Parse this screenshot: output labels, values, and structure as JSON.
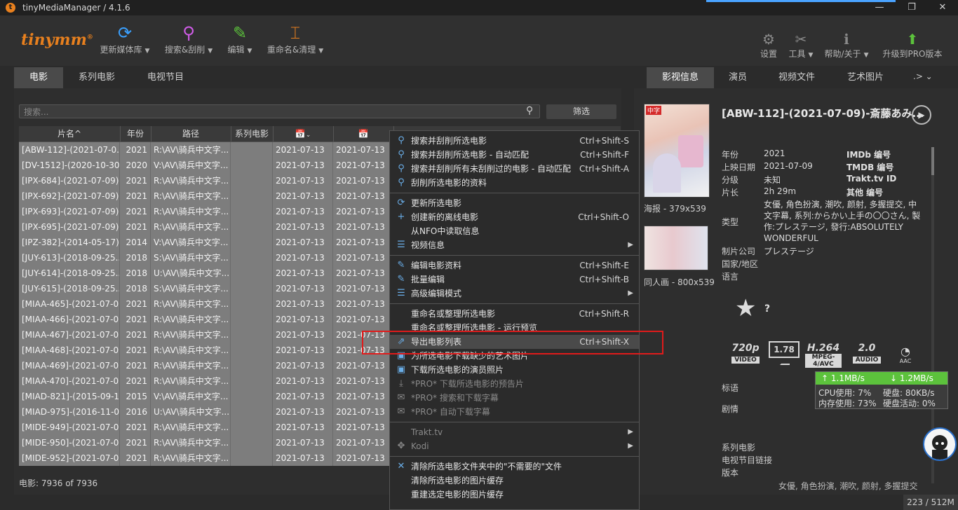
{
  "window": {
    "title": "tinyMediaManager / 4.1.6",
    "minimize": "—",
    "restore": "❐",
    "close": "✕"
  },
  "toolbar": {
    "logo": "tinymm",
    "logo_mark": "®",
    "items": [
      {
        "label": "更新媒体库",
        "icon": "refresh-icon",
        "glyph": "⟳",
        "color": "#3aa0ff"
      },
      {
        "label": "搜索&刮削",
        "icon": "search-magnify-icon",
        "glyph": "⚲",
        "color": "#d05ce8"
      },
      {
        "label": "编辑",
        "icon": "edit-pencil-icon",
        "glyph": "✎",
        "color": "#5cc23c"
      },
      {
        "label": "重命名&清理",
        "icon": "rename-icon",
        "glyph": "⌶",
        "color": "#e8801e"
      }
    ],
    "right_items": [
      {
        "label": "设置",
        "icon": "gear-icon",
        "glyph": "⚙"
      },
      {
        "label": "工具",
        "icon": "wrench-icon",
        "glyph": "✂"
      },
      {
        "label": "帮助/关于",
        "icon": "info-icon",
        "glyph": "ℹ"
      },
      {
        "label": "升级到PRO版本",
        "icon": "upgrade-arrow-icon",
        "glyph": "⬆"
      }
    ]
  },
  "left_tabs": [
    "电影",
    "系列电影",
    "电视节目"
  ],
  "search": {
    "placeholder": "搜索..."
  },
  "filter_label": "筛选",
  "table": {
    "headers": [
      "片名",
      "年份",
      "路径",
      "系列电影",
      "",
      ""
    ],
    "sort_marker": "^",
    "rows": [
      {
        "title": "[ABW-112]-(2021-07-0...",
        "year": "2021",
        "path": "R:\\AV\\骑兵中文字...",
        "series": "",
        "date1": "2021-07-13",
        "date2": "2021-07-13"
      },
      {
        "title": "[DV-1512]-(2020-10-30...",
        "year": "2020",
        "path": "V:\\AV\\骑兵中文字...",
        "series": "",
        "date1": "2021-07-13",
        "date2": "2021-07-13"
      },
      {
        "title": "[IPX-684]-(2021-07-09)...",
        "year": "2021",
        "path": "R:\\AV\\骑兵中文字...",
        "series": "",
        "date1": "2021-07-13",
        "date2": "2021-07-13"
      },
      {
        "title": "[IPX-692]-(2021-07-09)...",
        "year": "2021",
        "path": "R:\\AV\\骑兵中文字...",
        "series": "",
        "date1": "2021-07-13",
        "date2": "2021-07-13"
      },
      {
        "title": "[IPX-693]-(2021-07-09)...",
        "year": "2021",
        "path": "R:\\AV\\骑兵中文字...",
        "series": "",
        "date1": "2021-07-13",
        "date2": "2021-07-13"
      },
      {
        "title": "[IPX-695]-(2021-07-09)...",
        "year": "2021",
        "path": "R:\\AV\\骑兵中文字...",
        "series": "",
        "date1": "2021-07-13",
        "date2": "2021-07-13"
      },
      {
        "title": "[IPZ-382]-(2014-05-17)...",
        "year": "2014",
        "path": "V:\\AV\\骑兵中文字...",
        "series": "",
        "date1": "2021-07-13",
        "date2": "2021-07-13"
      },
      {
        "title": "[JUY-613]-(2018-09-25...",
        "year": "2018",
        "path": "S:\\AV\\骑兵中文字...",
        "series": "",
        "date1": "2021-07-13",
        "date2": "2021-07-13"
      },
      {
        "title": "[JUY-614]-(2018-09-25...",
        "year": "2018",
        "path": "U:\\AV\\骑兵中文字...",
        "series": "",
        "date1": "2021-07-13",
        "date2": "2021-07-13"
      },
      {
        "title": "[JUY-615]-(2018-09-25...",
        "year": "2018",
        "path": "S:\\AV\\骑兵中文字...",
        "series": "",
        "date1": "2021-07-13",
        "date2": "2021-07-13"
      },
      {
        "title": "[MIAA-465]-(2021-07-0...",
        "year": "2021",
        "path": "R:\\AV\\骑兵中文字...",
        "series": "",
        "date1": "2021-07-13",
        "date2": "2021-07-13"
      },
      {
        "title": "[MIAA-466]-(2021-07-0...",
        "year": "2021",
        "path": "R:\\AV\\骑兵中文字...",
        "series": "",
        "date1": "2021-07-13",
        "date2": "2021-07-13"
      },
      {
        "title": "[MIAA-467]-(2021-07-0...",
        "year": "2021",
        "path": "R:\\AV\\骑兵中文字...",
        "series": "",
        "date1": "2021-07-13",
        "date2": "2021-07-13"
      },
      {
        "title": "[MIAA-468]-(2021-07-0...",
        "year": "2021",
        "path": "R:\\AV\\骑兵中文字...",
        "series": "",
        "date1": "2021-07-13",
        "date2": "2021-07-13"
      },
      {
        "title": "[MIAA-469]-(2021-07-0...",
        "year": "2021",
        "path": "R:\\AV\\骑兵中文字...",
        "series": "",
        "date1": "2021-07-13",
        "date2": "2021-07-13"
      },
      {
        "title": "[MIAA-470]-(2021-07-0...",
        "year": "2021",
        "path": "R:\\AV\\骑兵中文字...",
        "series": "",
        "date1": "2021-07-13",
        "date2": "2021-07-13"
      },
      {
        "title": "[MIAD-821]-(2015-09-1...",
        "year": "2015",
        "path": "V:\\AV\\骑兵中文字...",
        "series": "",
        "date1": "2021-07-13",
        "date2": "2021-07-13"
      },
      {
        "title": "[MIAD-975]-(2016-11-0...",
        "year": "2016",
        "path": "U:\\AV\\骑兵中文字...",
        "series": "",
        "date1": "2021-07-13",
        "date2": "2021-07-13"
      },
      {
        "title": "[MIDE-949]-(2021-07-0...",
        "year": "2021",
        "path": "R:\\AV\\骑兵中文字...",
        "series": "",
        "date1": "2021-07-13",
        "date2": "2021-07-13"
      },
      {
        "title": "[MIDE-950]-(2021-07-0...",
        "year": "2021",
        "path": "R:\\AV\\骑兵中文字...",
        "series": "",
        "date1": "2021-07-13",
        "date2": "2021-07-13"
      },
      {
        "title": "[MIDE-952]-(2021-07-0...",
        "year": "2021",
        "path": "R:\\AV\\骑兵中文字...",
        "series": "",
        "date1": "2021-07-13",
        "date2": "2021-07-13"
      }
    ]
  },
  "status": {
    "text": "电影:  7936  of  7936"
  },
  "context_menu": {
    "groups": [
      [
        {
          "label": "搜索并刮削所选电影",
          "shortcut": "Ctrl+Shift-S",
          "icon": "search-icon",
          "glyph": "⚲"
        },
        {
          "label": "搜索并刮削所选电影 - 自动匹配",
          "shortcut": "Ctrl+Shift-F",
          "icon": "search-icon",
          "glyph": "⚲"
        },
        {
          "label": "搜索并刮削所有未刮削过的电影 - 自动匹配",
          "shortcut": "Ctrl+Shift-A",
          "icon": "search-icon",
          "glyph": "⚲"
        },
        {
          "label": "刮削所选电影的资料",
          "shortcut": "",
          "icon": "search-icon",
          "glyph": "⚲"
        }
      ],
      [
        {
          "label": "更新所选电影",
          "shortcut": "",
          "icon": "refresh-icon",
          "glyph": "⟳"
        },
        {
          "label": "创建新的离线电影",
          "shortcut": "Ctrl+Shift-O",
          "icon": "plus-icon",
          "glyph": "+"
        },
        {
          "label": "从NFO中读取信息",
          "shortcut": "",
          "icon": "",
          "glyph": ""
        },
        {
          "label": "视频信息",
          "shortcut": "",
          "icon": "list-icon",
          "glyph": "☰",
          "submenu": true
        }
      ],
      [
        {
          "label": "编辑电影资料",
          "shortcut": "Ctrl+Shift-E",
          "icon": "edit-icon",
          "glyph": "✎"
        },
        {
          "label": "批量编辑",
          "shortcut": "Ctrl+Shift-B",
          "icon": "edit-icon",
          "glyph": "✎"
        },
        {
          "label": "高级编辑模式",
          "shortcut": "",
          "icon": "list-icon",
          "glyph": "☰",
          "submenu": true
        }
      ],
      [
        {
          "label": "重命名或整理所选电影",
          "shortcut": "Ctrl+Shift-R",
          "icon": "",
          "glyph": ""
        },
        {
          "label": "重命名或整理所选电影 - 运行预览",
          "shortcut": "",
          "icon": "",
          "glyph": ""
        },
        {
          "label": "导出电影列表",
          "shortcut": "Ctrl+Shift-X",
          "icon": "export-icon",
          "glyph": "⇗",
          "highlighted": true
        },
        {
          "label": "为所选电影下载缺少的艺术图片",
          "shortcut": "",
          "icon": "image-icon",
          "glyph": "▣"
        },
        {
          "label": "下载所选电影的演员照片",
          "shortcut": "",
          "icon": "image-icon",
          "glyph": "▣"
        },
        {
          "label": "*PRO* 下载所选电影的预告片",
          "shortcut": "",
          "icon": "download-icon",
          "glyph": "⤓",
          "disabled": true
        },
        {
          "label": "*PRO* 搜索和下载字幕",
          "shortcut": "",
          "icon": "chat-icon",
          "glyph": "✉",
          "disabled": true
        },
        {
          "label": "*PRO* 自动下载字幕",
          "shortcut": "",
          "icon": "chat-icon",
          "glyph": "✉",
          "disabled": true
        }
      ],
      [
        {
          "label": "Trakt.tv",
          "shortcut": "",
          "icon": "",
          "glyph": "",
          "submenu": true,
          "disabled": true
        },
        {
          "label": "Kodi",
          "shortcut": "",
          "icon": "kodi-icon",
          "glyph": "✥",
          "submenu": true,
          "disabled": true
        }
      ],
      [
        {
          "label": "清除所选电影文件夹中的\"不需要的\"文件",
          "shortcut": "",
          "icon": "x-icon",
          "glyph": "✕"
        },
        {
          "label": "清除所选电影的图片缓存",
          "shortcut": "",
          "icon": "",
          "glyph": ""
        },
        {
          "label": "重建选定电影的图片缓存",
          "shortcut": "",
          "icon": "",
          "glyph": ""
        }
      ]
    ]
  },
  "right_tabs": [
    "影视信息",
    "演员",
    "视频文件",
    "艺术图片",
    "..."
  ],
  "details": {
    "title": "[ABW-112]-(2021-07-09)-斎藤あみ...",
    "poster_caption": "海报 - 379x539",
    "fanart_caption": "同人画 - 800x539",
    "poster_badge": "中字",
    "fields": [
      {
        "label": "年份",
        "value": "2021"
      },
      {
        "label": "上映日期",
        "value": "2021-07-09"
      },
      {
        "label": "分级",
        "value": "未知"
      },
      {
        "label": "片长",
        "value": "2h 29m"
      }
    ],
    "ids": [
      "IMDb 编号",
      "TMDB 编号",
      "Trakt.tv ID",
      "其他 编号"
    ],
    "genre_label": "类型",
    "genre_value": "女優, 角色扮演, 潮吹, 颜射, 多握提交, 中文字幕, 系列:からかい上手の〇〇さん, 製作:プレステージ, 發行:ABSOLUTELY WONDERFUL",
    "studio_label": "制片公司",
    "studio_value": "プレステージ",
    "country_label": "国家/地区",
    "language_label": "语言",
    "rating": "?",
    "media": {
      "resolution": "720p",
      "resolution_tag": "VIDEO",
      "aspect": "1.78",
      "codec": "H.264",
      "codec_tag": "MPEG-4/AVC",
      "audio": "2.0",
      "audio_tag": "AUDIO",
      "audio_codec": "AAC"
    },
    "tagline_label": "标语",
    "plot_label": "剧情",
    "collection_label": "系列电影",
    "tvlink_label": "电视节目链接",
    "version_label": "版本",
    "footer_tags": "女優, 角色扮演, 潮吹, 颜射, 多握提交"
  },
  "netmon": {
    "up": "↑  1.1MB/s",
    "down": "↓ 1.2MB/s",
    "cpu": "CPU使用: 7%",
    "disk": "硬盘: 80KB/s",
    "mem": "内存使用: 73%",
    "disk_activity": "硬盘活动: 0%"
  },
  "memory": "223 / 512M",
  "colors": {
    "accent": "#e8801e",
    "highlight_box": "#e01b1b",
    "netmon_green": "#5cc23c"
  }
}
